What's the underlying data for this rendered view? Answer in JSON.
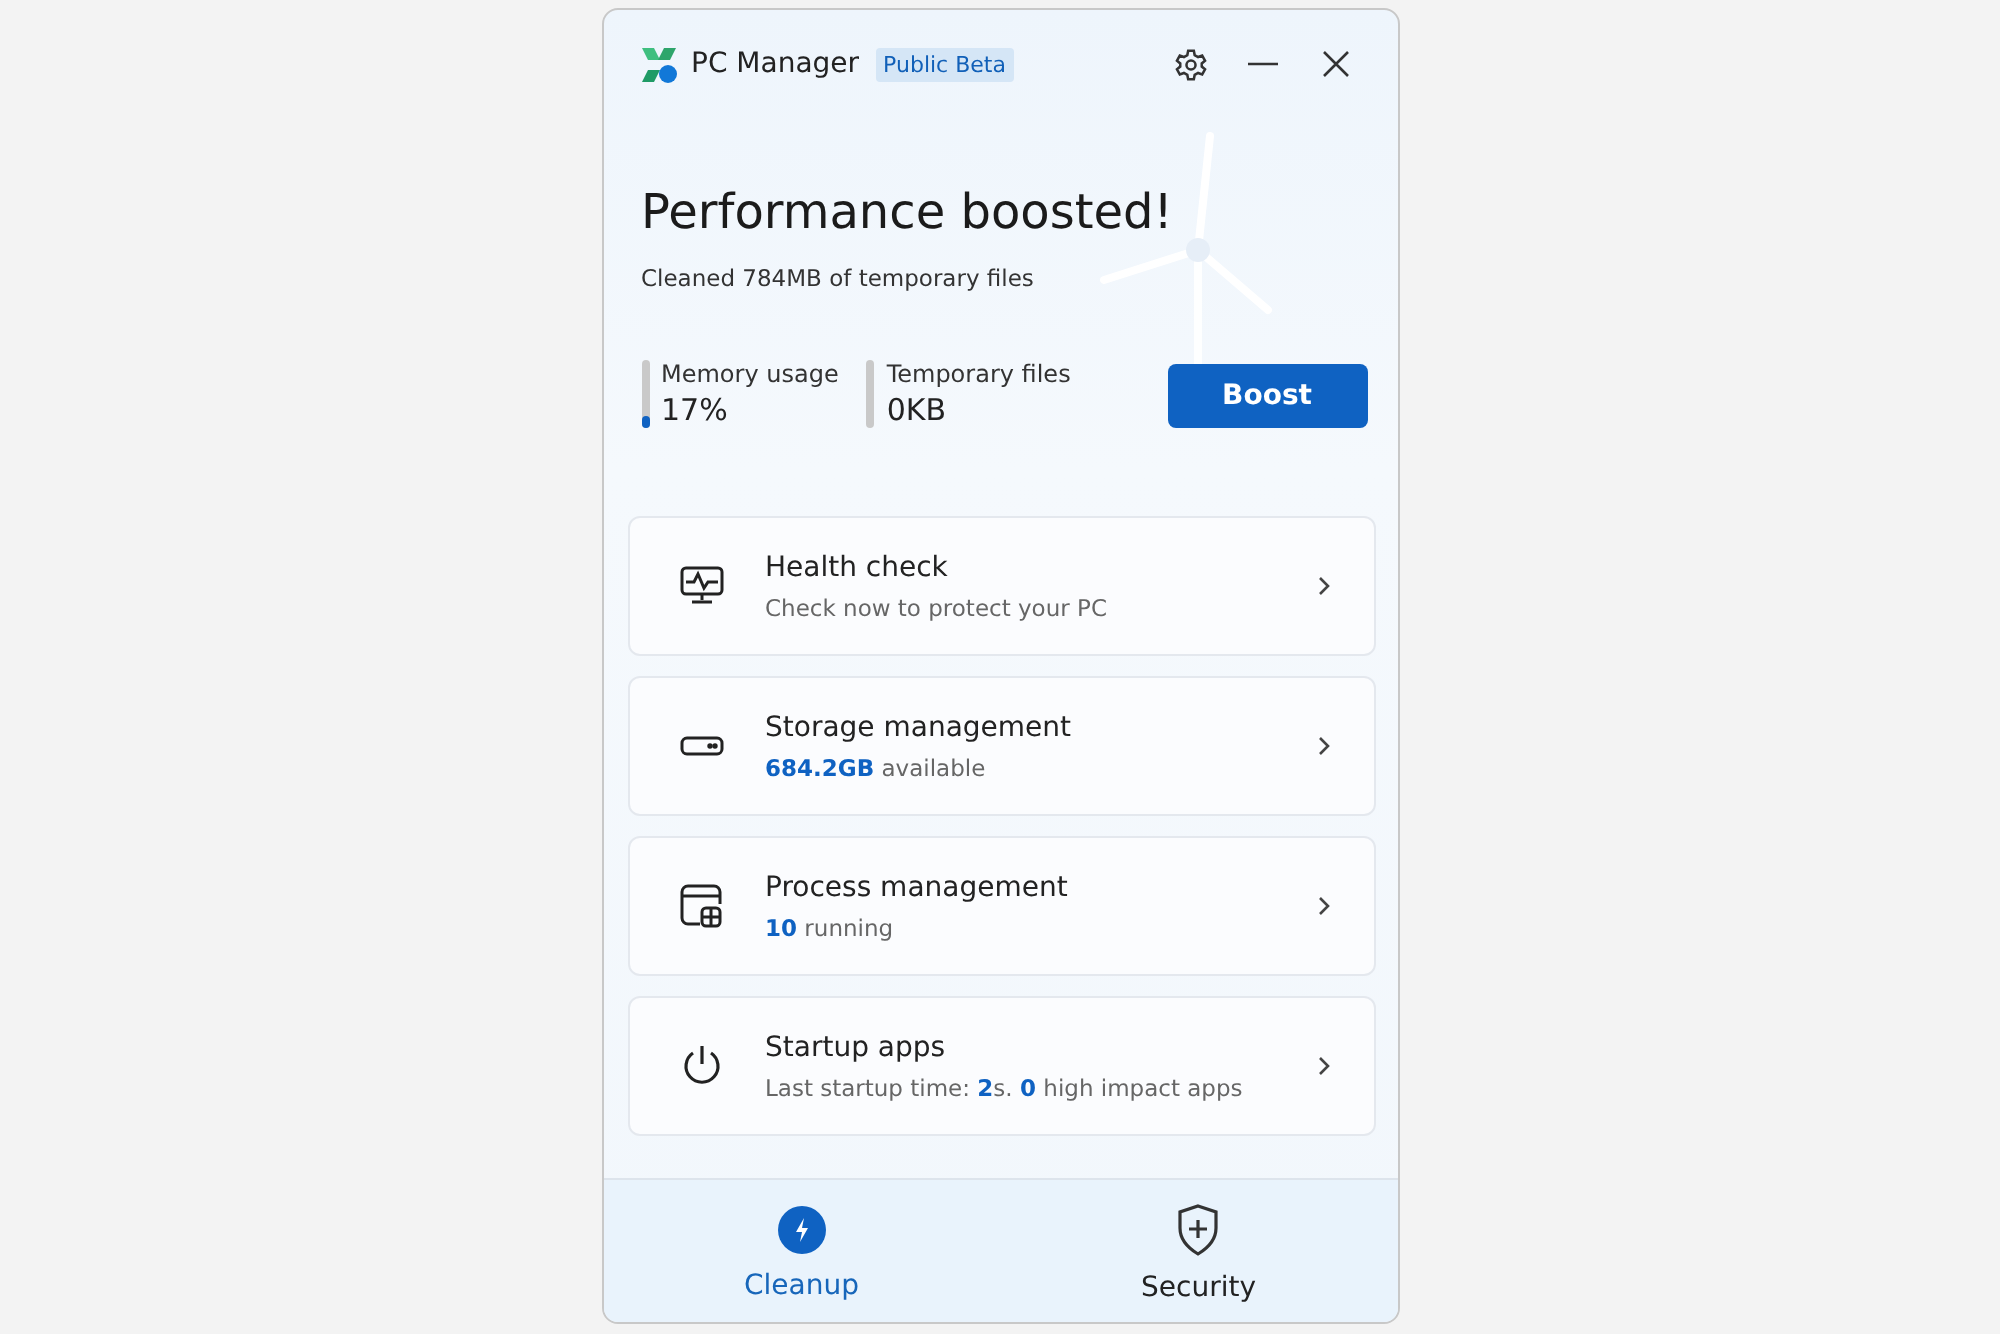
{
  "window": {
    "title": "PC Manager",
    "badge": "Public Beta"
  },
  "hero": {
    "heading": "Performance boosted!",
    "message": "Cleaned 784MB of temporary files"
  },
  "stats": [
    {
      "label": "Memory usage",
      "value": "17%",
      "level": 0.17
    },
    {
      "label": "Temporary files",
      "value": "0KB",
      "level": 0
    }
  ],
  "boost_button": "Boost",
  "cards": [
    {
      "kind": "health",
      "title": "Health check",
      "subtitle": "Check now to protect your PC"
    },
    {
      "kind": "storage",
      "title": "Storage management",
      "subtitle": "**684.2GB** available"
    },
    {
      "kind": "process",
      "title": "Process management",
      "subtitle": "**10** running"
    },
    {
      "kind": "startup",
      "title": "Startup apps",
      "subtitle": "Last startup time: **2**s. **0** high impact apps"
    }
  ],
  "nav": [
    {
      "kind": "cleanup",
      "label": "Cleanup",
      "selected": true
    },
    {
      "kind": "security",
      "label": "Security",
      "selected": false
    }
  ]
}
